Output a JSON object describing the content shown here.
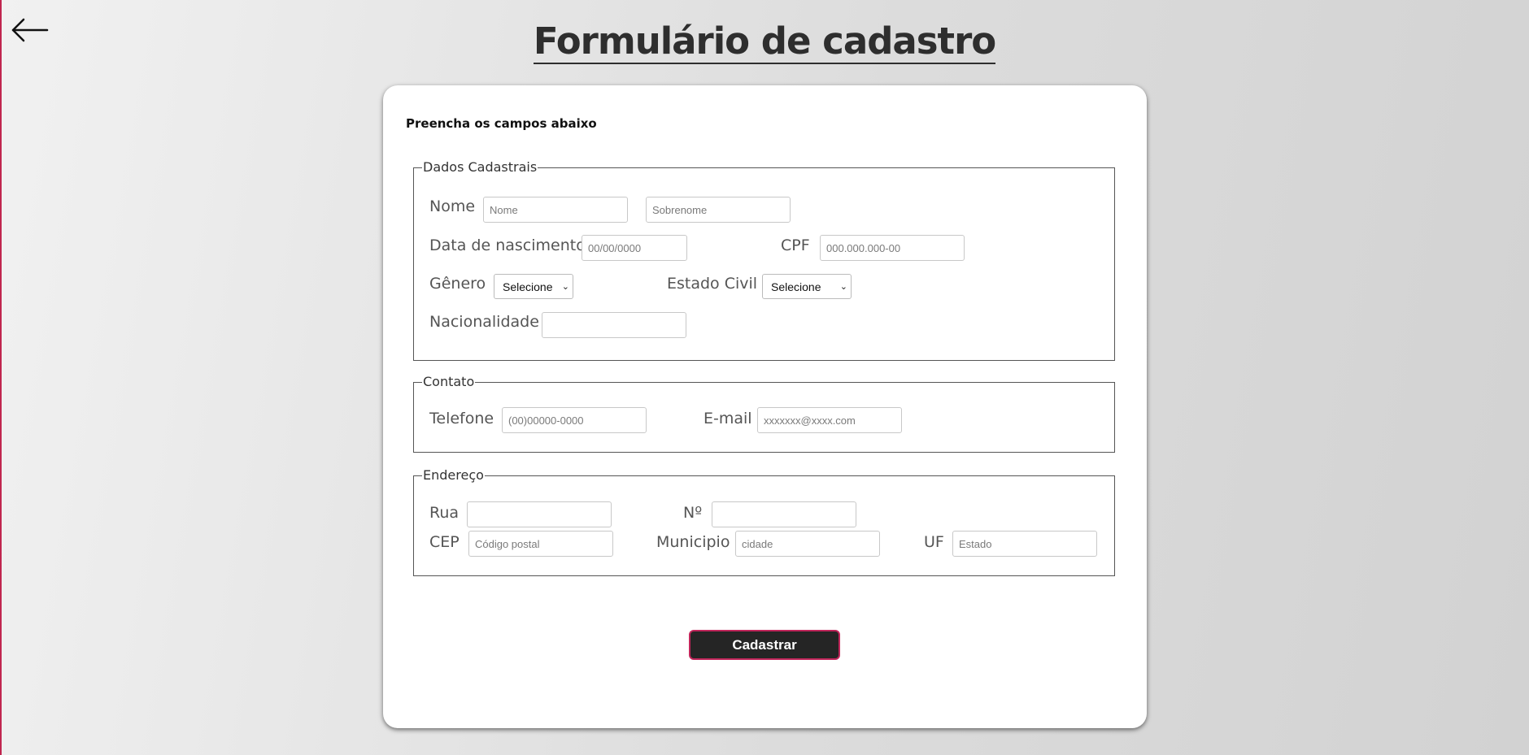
{
  "header": {
    "title": "Formulário de cadastro"
  },
  "form": {
    "instructions": "Preencha os campos abaixo",
    "dados": {
      "legend": "Dados Cadastrais",
      "nome_label": "Nome",
      "nome_placeholder": "Nome",
      "sobrenome_placeholder": "Sobrenome",
      "nascimento_label": "Data de nascimento",
      "nascimento_placeholder": "00/00/0000",
      "cpf_label": "CPF",
      "cpf_placeholder": "000.000.000-00",
      "genero_label": "Gênero",
      "genero_value": "Selecione",
      "estado_civil_label": "Estado Civil",
      "estado_civil_value": "Selecione",
      "nacionalidade_label": "Nacionalidade",
      "nacionalidade_placeholder": ""
    },
    "contato": {
      "legend": "Contato",
      "telefone_label": "Telefone",
      "telefone_placeholder": "(00)00000-0000",
      "email_label": "E-mail",
      "email_placeholder": "xxxxxxx@xxxx.com"
    },
    "endereco": {
      "legend": "Endereço",
      "rua_label": "Rua",
      "rua_placeholder": "",
      "numero_label": "Nº",
      "numero_placeholder": "",
      "cep_label": "CEP",
      "cep_placeholder": "Código postal",
      "municipio_label": "Municipio",
      "municipio_placeholder": "cidade",
      "uf_label": "UF",
      "uf_placeholder": "Estado"
    },
    "submit_label": "Cadastrar"
  },
  "icons": {
    "back": "arrow-left-icon",
    "select": "chevron-down-icon"
  },
  "colors": {
    "accent": "#c0264f",
    "button_bg": "#252525",
    "title": "#2e2e2e"
  }
}
